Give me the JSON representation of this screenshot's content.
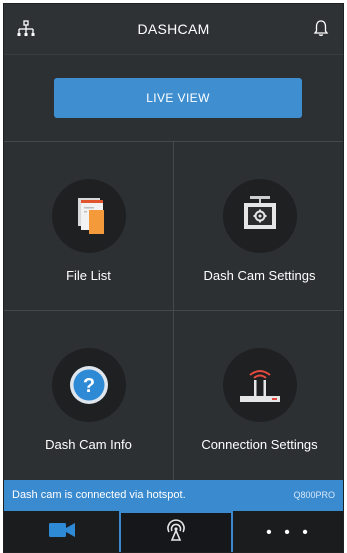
{
  "app": {
    "title": "DASHCAM"
  },
  "header": {
    "left_icon": "network-icon",
    "right_icon": "bell-icon"
  },
  "live_view": {
    "label": "LIVE VIEW"
  },
  "menu": [
    {
      "label": "File List",
      "icon": "file-list-icon"
    },
    {
      "label": "Dash Cam Settings",
      "icon": "dashcam-settings-icon"
    },
    {
      "label": "Dash Cam Info",
      "icon": "info-question-icon"
    },
    {
      "label": "Connection Settings",
      "icon": "router-connection-icon"
    }
  ],
  "status": {
    "message": "Dash cam is connected via hotspot.",
    "model": "Q800PRO"
  },
  "bottom_nav": {
    "tabs": [
      {
        "icon": "video-camera-icon"
      },
      {
        "icon": "hotspot-icon",
        "selected": true
      },
      {
        "icon": "more-icon",
        "label": "• • •"
      }
    ]
  },
  "colors": {
    "accent": "#3f8fd0",
    "background": "#2d3033",
    "circle": "#1e2022"
  }
}
